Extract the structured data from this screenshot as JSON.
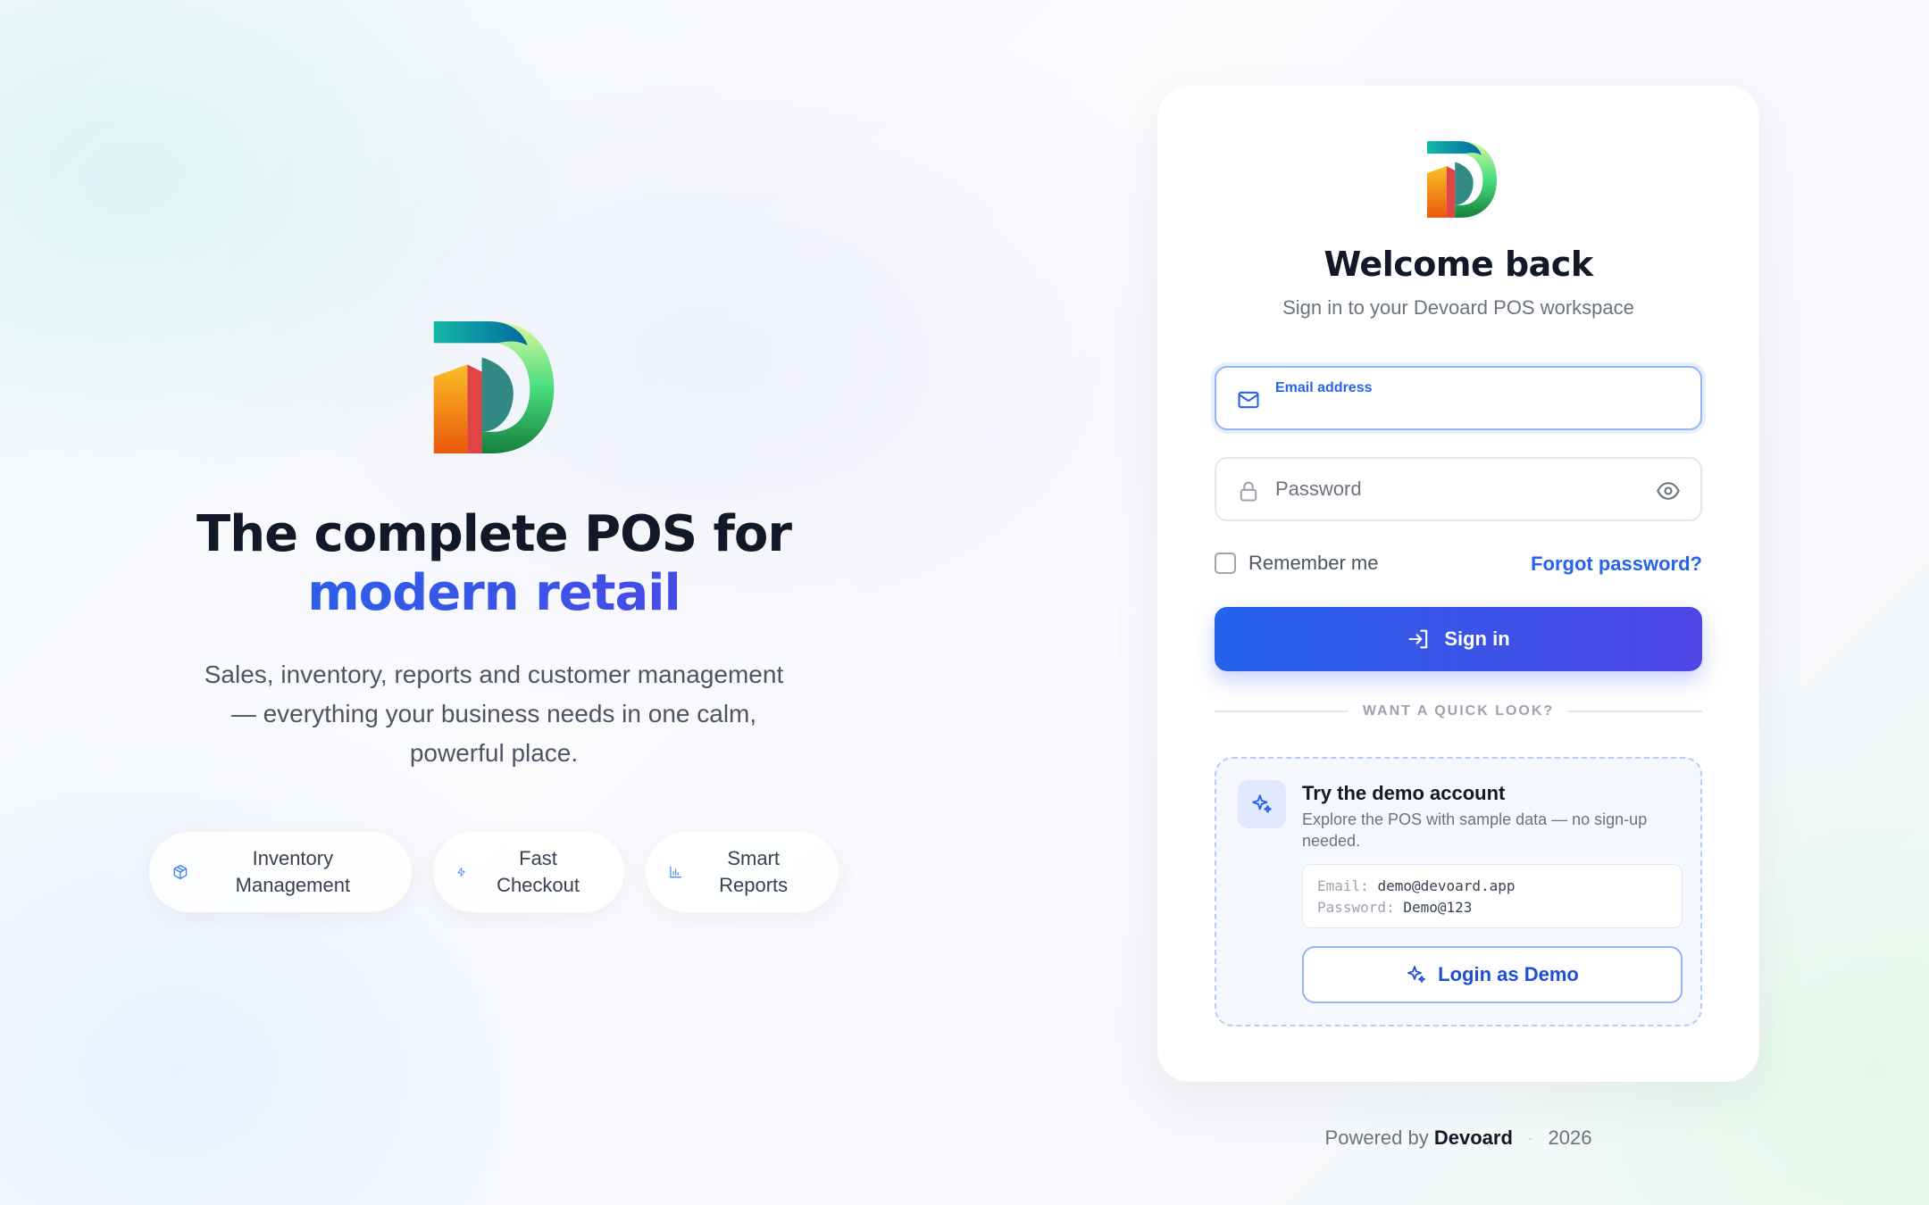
{
  "hero": {
    "title_line1": "The complete POS for",
    "title_line2": "modern retail",
    "subtitle": "Sales, inventory, reports and customer management — everything your business needs in one calm, powerful place.",
    "features": [
      {
        "icon": "box-icon",
        "label": "Inventory Management"
      },
      {
        "icon": "bolt-icon",
        "label": "Fast Checkout"
      },
      {
        "icon": "bar-chart-icon",
        "label": "Smart Reports"
      }
    ]
  },
  "login": {
    "title": "Welcome back",
    "subtitle": "Sign in to your Devoard POS workspace",
    "email_label": "Email address",
    "email_value": "",
    "password_placeholder": "Password",
    "remember_label": "Remember me",
    "forgot_label": "Forgot password?",
    "signin_label": "Sign in",
    "divider_text": "WANT A QUICK LOOK?"
  },
  "demo": {
    "title": "Try the demo account",
    "description": "Explore the POS with sample data — no sign-up needed.",
    "email_key": "Email:",
    "email_value": "demo@devoard.app",
    "password_key": "Password:",
    "password_value": "Demo@123",
    "button_label": "Login as Demo"
  },
  "footer": {
    "powered_by": "Powered by",
    "brand": "Devoard",
    "separator": "·",
    "year": "2026"
  },
  "colors": {
    "accent": "#2563eb",
    "accent_end": "#4f46e5",
    "heading": "#111827",
    "muted": "#6b7280"
  }
}
